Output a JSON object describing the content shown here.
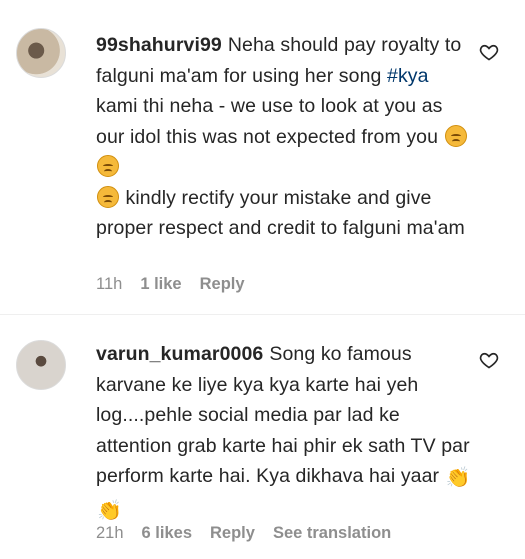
{
  "comments": [
    {
      "username": "99shahurvi99",
      "text_part1": "Neha should pay royalty to falguni ma'am for using her song ",
      "hashtag": "#kya",
      "text_part2": " kami thi neha - we use to look at you as our idol this was not expected from you ",
      "text_part3": " kindly rectify your mistake and give proper respect and credit to falguni ma'am",
      "time": "11h",
      "likes": "1 like",
      "reply": "Reply"
    },
    {
      "username": "varun_kumar0006",
      "text": "Song ko famous karvane ke liye kya kya karte hai yeh log....pehle social media par lad ke attention grab karte hai phir ek sath TV par perform karte hai. Kya dikhava hai yaar ",
      "time": "21h",
      "likes": "6 likes",
      "reply": "Reply",
      "see_translation": "See translation"
    }
  ],
  "icons": {
    "like": "heart-outline-icon",
    "emoji_sad": "pensive-face-emoji",
    "emoji_clap": "clapping-hands-emoji"
  },
  "colors": {
    "text": "#262626",
    "muted": "#8e8e8e",
    "hashtag": "#00376b",
    "background": "#ffffff"
  }
}
